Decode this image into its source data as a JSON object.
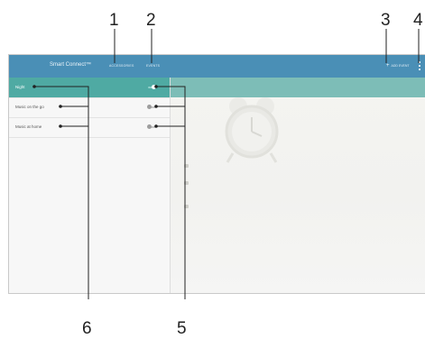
{
  "callouts": [
    "1",
    "2",
    "3",
    "4",
    "5",
    "6"
  ],
  "actionbar": {
    "title": "Smart Connect™",
    "tabs": [
      "Accessories",
      "Events"
    ],
    "add_event_label": "Add event",
    "menu_icon": "overflow-menu-icon",
    "add_icon": "plus-icon"
  },
  "events": [
    {
      "name": "Night",
      "enabled": true
    },
    {
      "name": "Music on the go",
      "enabled": false
    },
    {
      "name": "Music at home",
      "enabled": false
    }
  ],
  "colors": {
    "actionbar": "#4a8fb6",
    "selected_row": "#4faaa3",
    "callout_line": "#222222"
  }
}
